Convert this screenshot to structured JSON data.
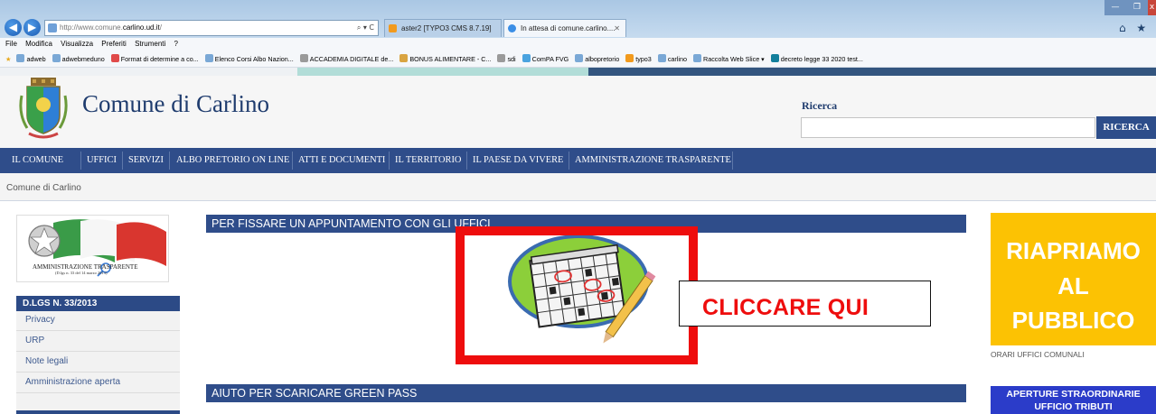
{
  "browser": {
    "address_prefix": "http://www.comune.",
    "address_domain": "carlino.ud.it",
    "address_suffix": "/",
    "address_controls": "⌕ ▾ C",
    "tabs": [
      {
        "label": "aster2 [TYPO3 CMS 8.7.19]"
      },
      {
        "label": "In attesa di comune.carlino....",
        "close": "✕"
      }
    ],
    "window_controls": {
      "minimize": "—",
      "maximize": "❐",
      "close": "x"
    },
    "right_icons": "⌂ ★"
  },
  "menubar": {
    "items": [
      "File",
      "Modifica",
      "Visualizza",
      "Preferiti",
      "Strumenti",
      "?"
    ]
  },
  "favorites": {
    "items": [
      "adweb",
      "adwebmeduno",
      "Format di determine a co...",
      "Elenco Corsi Albo Nazion...",
      "ACCADEMIA DIGITALE de...",
      "BONUS ALIMENTARE - C...",
      "sdi",
      "ComPA FVG",
      "albopretorio",
      "typo3",
      "carlino",
      "Raccolta Web Slice ▾",
      "decreto legge 33 2020 test..."
    ]
  },
  "header": {
    "title": "Comune di Carlino",
    "search_label": "Ricerca",
    "search_placeholder": "",
    "search_button": "RICERCA"
  },
  "nav": {
    "items": [
      "IL COMUNE",
      "UFFICI",
      "SERVIZI",
      "ALBO PRETORIO ON LINE",
      "ATTI E DOCUMENTI",
      "IL TERRITORIO",
      "IL PAESE DA VIVERE",
      "AMMINISTRAZIONE TRASPARENTE"
    ]
  },
  "breadcrumb": "Comune di Carlino",
  "left_sidebar": {
    "logo_text": "AMMINISTRAZIONE TRASPARENTE",
    "logo_subtext": "(D.lgs n. 33 del 14 marzo 2013)",
    "section_title": "D.LGS N. 33/2013",
    "links": [
      "Privacy",
      "URP",
      "Note legali",
      "Amministrazione aperta"
    ]
  },
  "main": {
    "section1_title": "PER FISSARE UN APPUNTAMENTO CON GLI UFFICI",
    "cta_text": "CLICCARE QUI",
    "section2_title": "AIUTO PER SCARICARE GREEN PASS"
  },
  "right_sidebar": {
    "banner_lines": [
      "RIAPRIAMO",
      "AL",
      "PUBBLICO"
    ],
    "orari_text": "ORARI UFFICI COMUNALI",
    "blue_banner_lines": [
      "APERTURE STRAORDINARIE",
      "UFFICIO TRIBUTI"
    ]
  },
  "colors": {
    "nav_blue": "#2f4d8a",
    "cta_red": "#ee0d0d",
    "banner_yellow": "#fcc203",
    "banner_blue": "#2b3cc9"
  }
}
